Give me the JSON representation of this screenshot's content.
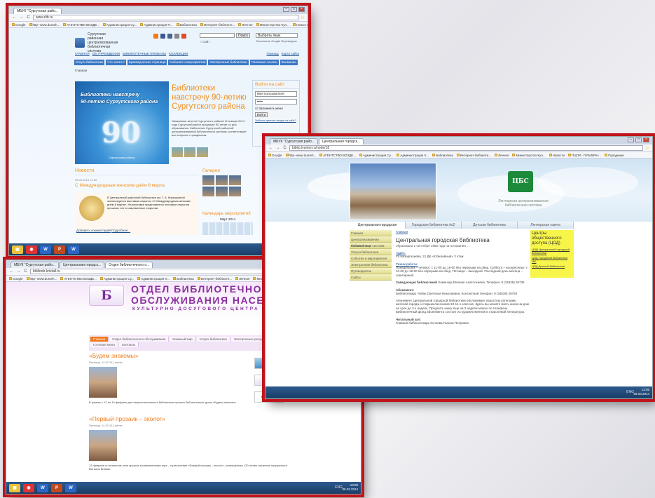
{
  "w1": {
    "tab": "МБУК \"Сургутская райо...",
    "url": "www.rlib.ru",
    "bookmarks": [
      "Google",
      "http--www.dumeh...",
      "АГЕНТСТВО ВОЗДЕ...",
      "Администрация Су...",
      "Администрация П...",
      "Библиотека",
      "Интернет-библиоте...",
      "Личное",
      "Министерство Кул...",
      "Новости",
      "ПЦПИ - ПУБЛИЧН...",
      "Праздники"
    ],
    "org": "Сургутская районная централизованная библиотечная система",
    "search_btn": "Поиск",
    "lang": "Выбрать язык",
    "gtranslate": "Технологии Google Переводчик",
    "radio": "Сайт",
    "links": [
      "ГЛАВНАЯ",
      "ОБ УЧРЕЖДЕНИИ",
      "БИБЛИОТЕЧНЫЕ ФИЛИАЛЫ",
      "КОЛЛЕКЦИИ"
    ],
    "links_right": [
      "Помощь",
      "Карта сайта"
    ],
    "nav": [
      "Услуги библиотеки",
      "Что читать?",
      "Краеведческая страница",
      "События и мероприятия",
      "Электронные библиотеки",
      "Полезные ссылки",
      "Внимание"
    ],
    "crumb": "Главная",
    "banner_l1": "Библиотеки навстречу",
    "banner_l2": "90-летию Сургутского района",
    "banner_num": "90",
    "banner_cap": "Сургутскому району",
    "headline": "Библиотеки навстречу 90-летию Сургутского района",
    "headline_text": "Уважаемые жители Сургутского района! 11 января 2014 года Сургутский район празднует 90-летие со дня образования. Библиотеки Сургутской районной централизованной библиотечной системы соответствуют все вопросы с праздником.",
    "login_h": "Войти на сайт",
    "login_user": "Имя пользователя",
    "login_pass": "•••••",
    "login_remember": "Запомнить меня",
    "login_btn": "Войти",
    "login_forgot": "Забыли данные входа на сайт?",
    "news_h": "Новости",
    "news_date": "06.03.2014 12:55",
    "news_title": "С Международным женским днём 8 марта",
    "news_text": "В Центральной районной библиотеке им. Г. А. Кирюшкиной экспонируется выставка открыток «С Международным женским днём 8 марта». На выставке представлены почтовые открытки прошлых лет и современные открытки.",
    "news_link1": "Добавить комментарий",
    "news_link2": "Подробнее...",
    "gallery_h": "Галерея",
    "cal_h": "Календарь мероприятий",
    "cal_m": "Март 2014"
  },
  "w2": {
    "tabs": [
      "МБУК \"Сургутская райо...",
      "Центральная городск..."
    ],
    "url": "biblio.lyantor.ru/node/18",
    "bookmarks": [
      "Google",
      "http--www.dumeh...",
      "АГЕНТСТВО ВОЗДЕ...",
      "Администрация Су...",
      "Администрация Х...",
      "Библиотека",
      "Интернет-библиоте...",
      "Личное",
      "Министерство Кул...",
      "Новости",
      "ПЦПИ - ПУБЛИЧН...",
      "Праздники"
    ],
    "logo": "ЦБС",
    "logo_text": "Лянторская централизованная библиотечная система",
    "tabs2": [
      "Центральная городская библиотека",
      "Городская библиотека №2",
      "Детская библиотека",
      "Лянторская газета"
    ],
    "left": [
      "Главная",
      "Централизованная библиотечная система",
      "Книжный мир",
      "Услуги библиотеки",
      "События и мероприятия",
      "Электронная библиотека",
      "Путеводитель",
      "Сайты"
    ],
    "crumb": "Главная",
    "title": "Центральная городская библиотека",
    "sub": "образована 2 сентября 1955 года на основании ...",
    "addr_h": "Адрес:",
    "addr": "Ул.Назаргалеева, 21 ДК «Юбилейный» 3 этаж",
    "mode_h": "Режим работы:",
    "mode": "Понедельник – четверг: с 11-00 до 19-00 без перерыва на обед. Суббота – воскресенье: с 10-00 до 18-00 без перерыва на обед. Пятница – выходной. Последний день месяца – санитарный.",
    "head_h": "Заведующая библиотекой",
    "head": "Хоменчук Евгения Анатольевна. Телефон: 8 (34638) 26735",
    "ab_h": "Абонемент:",
    "ab": "Библиотекарь Чобан Светлана Николаевна. Контактный телефон: 8 (34638) 28793",
    "ab_text": "Абонемент Центральной городской библиотеки обслуживает взрослую категорию жителей города и старшеклассников 10-11-х классов. Здесь вы можете взять книги на дом на срок до 2-х недель. Продлить книгу еще на 2 недели можно по телефону. Библиотечный фонд абонемента состоит из художественной и отраслевой литературы.",
    "hall_h": "Читальный зал:",
    "hall": "Главный библиотекарь Кочнева Галина Петровна",
    "right_h": "Центры общественного доступа (ЦОД)",
    "right_links": [
      "ЦОД Центральной городской библиотеки",
      "ЦОД Городской библиотеки №2",
      "ЦОД Детской библиотеки"
    ]
  },
  "w3": {
    "tabs": [
      "МБУК \"Сургутская райо...",
      "Центральная городск...",
      "Отдел библиотечного о..."
    ],
    "url": "biblioob-kristall.ru",
    "bookmarks": [
      "Google",
      "http--www.dumeh...",
      "АГЕНТСТВО ВОЗДЕ...",
      "Администрация Су...",
      "Администрация Х...",
      "Библиотека",
      "Интернет-библиоте...",
      "Личное",
      "Министерство Кул...",
      "Новости",
      "ПЦПИ - ПУБЛИЧН...",
      "Праздники"
    ],
    "logo": "Б",
    "title1": "ОТДЕЛ БИБЛИОТЕЧНОГО",
    "title2": "ОБСЛУЖИВАНИЯ НАСЕЛЕНИЯ",
    "title3": "КУЛЬТУРНО ДОСУГОВОГО ЦЕНТРА КРИСТАЛЛ",
    "nav": [
      "Главная",
      "Отдел библиотечного обслуживания",
      "Книжный мир",
      "Услуги библиотеки",
      "Электронные ресурсы",
      "Гостевая книга",
      "Контакты"
    ],
    "post1_h": "«Будем знакомы»",
    "post1_m": "Пятница, 14.02.14 | admin",
    "post1_p": "В рамках с 12 по 14 февраля для первоклассников в библиотеке прошли библиотечные уроки «Будем знакомы».",
    "post2_h": "«Первый прозаик – эколог»",
    "post2_m": "Пятница, 14.02.14 | admin",
    "post2_p": "12 февраля в читальном зале прошла познавательная игра – путешествие «Первый прозаик – эколог», посвященная 120-летию писателя-натуралиста Виталия Бианки.",
    "side": [
      "",
      "",
      "KRISTALL"
    ]
  },
  "taskbar": {
    "time": "13:05",
    "date": "06.03.2014",
    "lang": "ENG"
  }
}
